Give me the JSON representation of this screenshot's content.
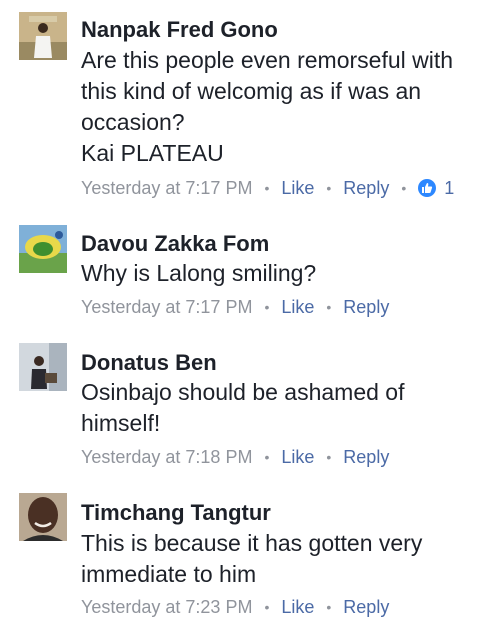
{
  "comments": [
    {
      "author": "Nanpak Fred Gono",
      "text": "Are this people even remorseful with\nthis kind of welcomig as if was an\noccasion?\nKai PLATEAU",
      "time": "Yesterday at 7:17 PM",
      "like": "Like",
      "reply": "Reply",
      "reaction_count": "1"
    },
    {
      "author": "Davou Zakka Fom",
      "text": "Why is Lalong smiling?",
      "time": "Yesterday at 7:17 PM",
      "like": "Like",
      "reply": "Reply"
    },
    {
      "author": "Donatus Ben",
      "text": "Osinbajo should be ashamed of\nhimself!",
      "time": "Yesterday at 7:18 PM",
      "like": "Like",
      "reply": "Reply"
    },
    {
      "author": "Timchang Tangtur",
      "text": "This is because it has gotten very\nimmediate to him",
      "time": "Yesterday at 7:23 PM",
      "like": "Like",
      "reply": "Reply"
    }
  ],
  "separator": "•",
  "colors": {
    "name": "#1d2129",
    "meta": "#90949c",
    "link": "#4b6aa6",
    "like_badge": "#2d88ff"
  }
}
